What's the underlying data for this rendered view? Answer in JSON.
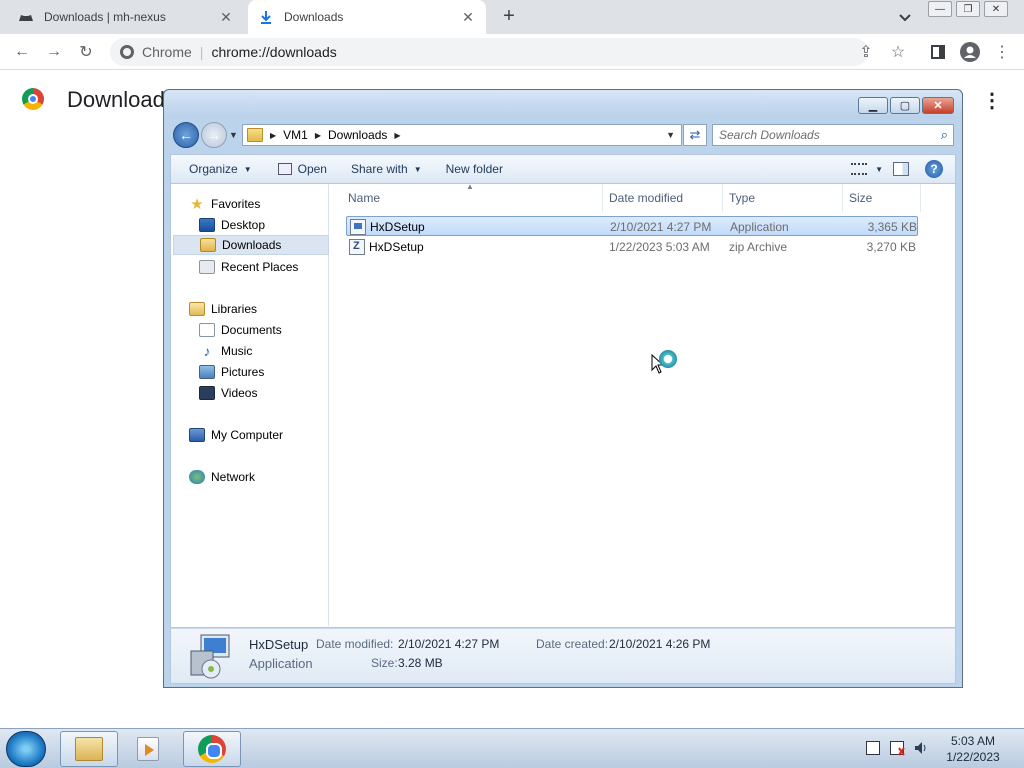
{
  "browser": {
    "tabs": [
      {
        "label": "Downloads | mh-nexus",
        "active": false
      },
      {
        "label": "Downloads",
        "active": true
      }
    ],
    "new_tab": "+",
    "omnibox": {
      "site": "Chrome",
      "url": "chrome://downloads"
    }
  },
  "downloads_page": {
    "title": "Downloads"
  },
  "explorer": {
    "breadcrumb": [
      "VM1",
      "Downloads"
    ],
    "search_placeholder": "Search Downloads",
    "commands": {
      "organize": "Organize",
      "open": "Open",
      "share_with": "Share with",
      "new_folder": "New folder"
    },
    "nav": {
      "favorites": "Favorites",
      "desktop": "Desktop",
      "downloads": "Downloads",
      "recent_places": "Recent Places",
      "libraries": "Libraries",
      "documents": "Documents",
      "music": "Music",
      "pictures": "Pictures",
      "videos": "Videos",
      "my_computer": "My Computer",
      "network": "Network"
    },
    "columns": {
      "name": "Name",
      "date": "Date modified",
      "type": "Type",
      "size": "Size"
    },
    "files": [
      {
        "name": "HxDSetup",
        "date": "2/10/2021 4:27 PM",
        "type": "Application",
        "size": "3,365 KB",
        "icon": "app"
      },
      {
        "name": "HxDSetup",
        "date": "1/22/2023 5:03 AM",
        "type": "zip Archive",
        "size": "3,270 KB",
        "icon": "zip"
      }
    ],
    "details": {
      "name": "HxDSetup",
      "kind": "Application",
      "date_modified_label": "Date modified:",
      "date_modified": "2/10/2021 4:27 PM",
      "date_created_label": "Date created:",
      "date_created": "2/10/2021 4:26 PM",
      "size_label": "Size:",
      "size": "3.28 MB"
    }
  },
  "taskbar": {
    "clock_time": "5:03 AM",
    "clock_date": "1/22/2023"
  }
}
